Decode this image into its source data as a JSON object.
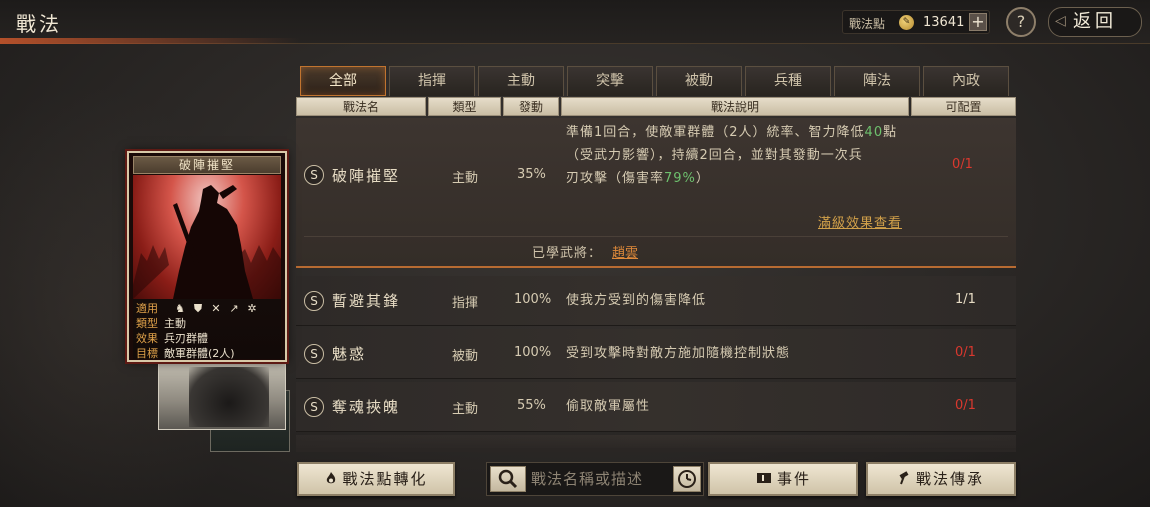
{
  "header": {
    "title": "戰法",
    "points_label": "戰法點",
    "points_value": "13641",
    "add_label": "+",
    "help_label": "?",
    "back_label": "返回"
  },
  "tabs": [
    {
      "label": "全部",
      "active": true
    },
    {
      "label": "指揮",
      "active": false
    },
    {
      "label": "主動",
      "active": false
    },
    {
      "label": "突擊",
      "active": false
    },
    {
      "label": "被動",
      "active": false
    },
    {
      "label": "兵種",
      "active": false
    },
    {
      "label": "陣法",
      "active": false
    },
    {
      "label": "內政",
      "active": false
    }
  ],
  "columns": [
    "戰法名",
    "類型",
    "發動",
    "戰法說明",
    "可配置"
  ],
  "selected": {
    "grade": "S",
    "name": "破陣摧堅",
    "type": "主動",
    "rate": "35%",
    "desc_lines": [
      [
        "準備1回合，使敵軍群體（2人）統率、智力降低",
        "40",
        "點"
      ],
      [
        "（受武力影響），持續2回合，並對其發動一次兵"
      ],
      [
        "刃攻擊（傷害率",
        "79%",
        "）"
      ]
    ],
    "capacity": "0/1",
    "max_effect_link": "滿級效果查看",
    "learned_label": "已學武將：",
    "learned_general": "趙雲"
  },
  "rows": [
    {
      "grade": "S",
      "name": "暫避其鋒",
      "type": "指揮",
      "rate": "100%",
      "desc": "使我方受到的傷害降低",
      "capacity": "1/1",
      "cap_color": "white"
    },
    {
      "grade": "S",
      "name": "魅惑",
      "type": "被動",
      "rate": "100%",
      "desc": "受到攻擊時對敵方施加隨機控制狀態",
      "capacity": "0/1",
      "cap_color": "red"
    },
    {
      "grade": "S",
      "name": "奪魂挾魄",
      "type": "主動",
      "rate": "55%",
      "desc": "偷取敵軍屬性",
      "capacity": "0/1",
      "cap_color": "red"
    }
  ],
  "card": {
    "title": "破陣摧堅",
    "applies_key": "適用",
    "applies_icons": [
      "cavalry-icon",
      "shield-icon",
      "bow-icon",
      "spear-icon",
      "wheel-icon"
    ],
    "type_key": "類型",
    "type_val": "主動",
    "effect_key": "效果",
    "effect_val": "兵刃群體",
    "target_key": "目標",
    "target_val": "敵軍群體(2人)"
  },
  "bottom": {
    "convert_label": "戰法點轉化",
    "search_placeholder": "戰法名稱或描述",
    "events_label": "事件",
    "inherit_label": "戰法傳承"
  },
  "colors": {
    "accent": "#c1742f",
    "highlight_number": "#6ec16e",
    "capacity_full": "#d9382e",
    "link": "#d2a14a",
    "general": "#e08a3a"
  }
}
